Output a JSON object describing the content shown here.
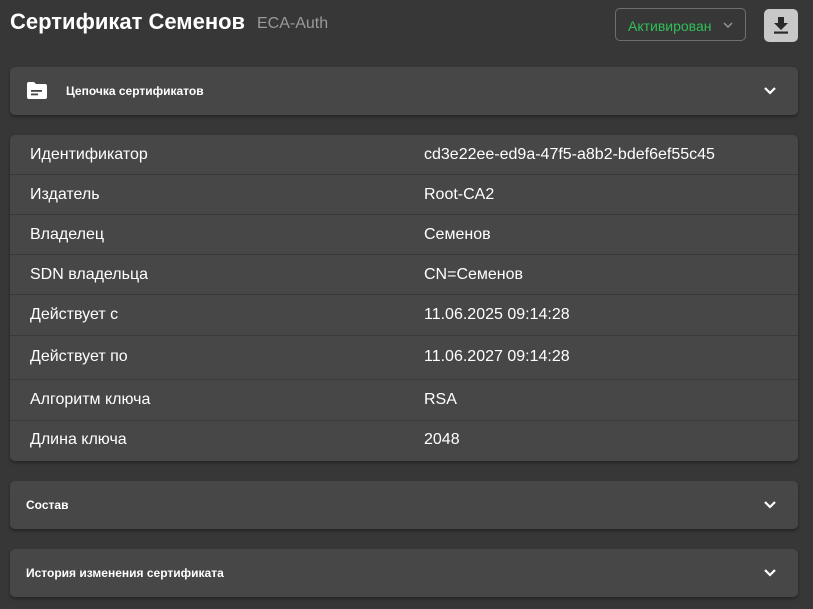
{
  "header": {
    "title": "Сертификат Семенов",
    "subtitle": "ECA-Auth",
    "status": {
      "label": "Активирован",
      "color": "#2fbf59"
    },
    "download_icon": "download-icon"
  },
  "chain": {
    "label": "Цепочка сертификатов",
    "icon": "folder-icon"
  },
  "details": [
    {
      "key": "Идентификатор",
      "value": "cd3e22ee-ed9a-47f5-a8b2-bdef6ef55c45"
    },
    {
      "key": "Издатель",
      "value": "Root-CA2"
    },
    {
      "key": "Владелец",
      "value": "Семенов"
    },
    {
      "key": "SDN владельца",
      "value": "CN=Семенов"
    },
    {
      "key": "Действует с",
      "value": "11.06.2025 09:14:28"
    },
    {
      "key": "Действует по",
      "value": "11.06.2027 09:14:28"
    },
    {
      "key": "Алгоритм ключа",
      "value": "RSA"
    },
    {
      "key": "Длина ключа",
      "value": "2048"
    }
  ],
  "composition": {
    "label": "Состав"
  },
  "history": {
    "label": "История изменения сертификата"
  }
}
